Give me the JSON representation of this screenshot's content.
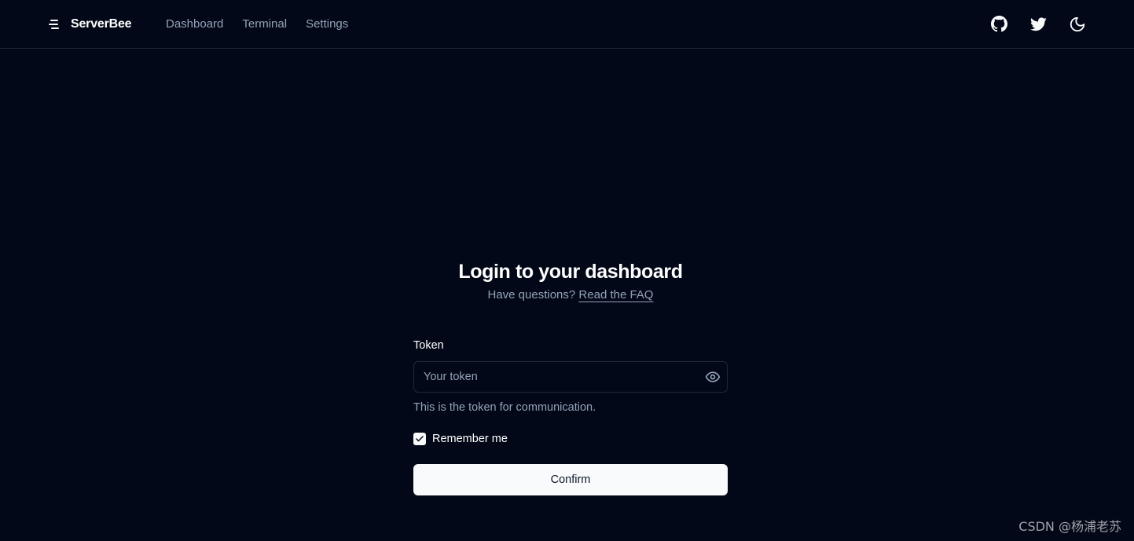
{
  "header": {
    "brand": "ServerBee",
    "nav": [
      {
        "label": "Dashboard"
      },
      {
        "label": "Terminal"
      },
      {
        "label": "Settings"
      }
    ],
    "icons": [
      "github-icon",
      "twitter-icon",
      "moon-icon"
    ]
  },
  "login": {
    "title": "Login to your dashboard",
    "subtitle_prefix": "Have questions?",
    "faq_link": "Read the FAQ",
    "token_label": "Token",
    "token_value": "",
    "token_placeholder": "Your token",
    "token_helper": "This is the token for communication.",
    "remember_label": "Remember me",
    "remember_checked": true,
    "confirm_label": "Confirm"
  },
  "watermark": "CSDN @杨浦老苏",
  "colors": {
    "background": "#020817",
    "muted_text": "#94a3b8",
    "border": "#1e293b",
    "button_bg": "#f8fafc"
  }
}
